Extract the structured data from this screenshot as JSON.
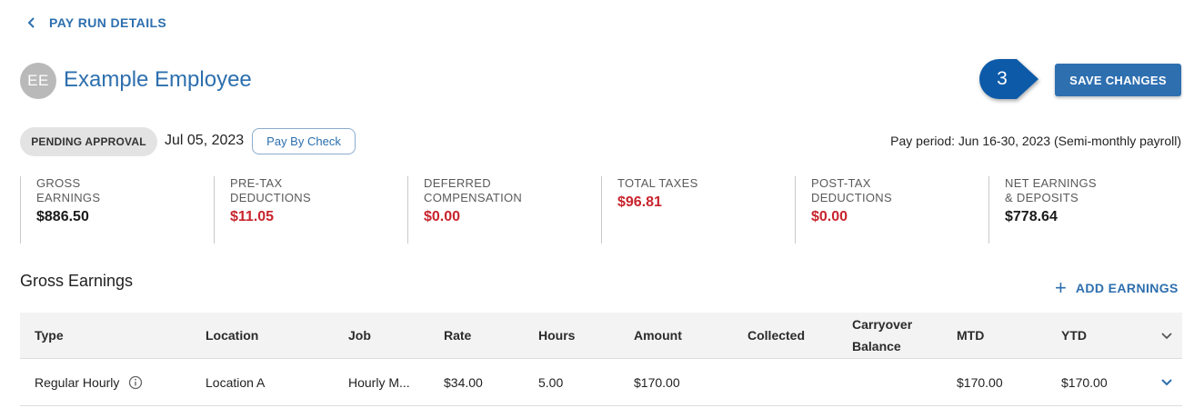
{
  "nav": {
    "back_label": "PAY RUN DETAILS"
  },
  "employee": {
    "initials": "EE",
    "name": "Example Employee"
  },
  "step_badge": {
    "number": "3",
    "color": "#0f5aa8"
  },
  "actions": {
    "save_label": "SAVE CHANGES"
  },
  "status": {
    "badge": "PENDING APPROVAL",
    "pay_date": "Jul 05, 2023",
    "payment_method": "Pay By Check",
    "pay_period": "Pay period: Jun 16-30, 2023 (Semi-monthly payroll)"
  },
  "summary": [
    {
      "label": "GROSS EARNINGS",
      "value": "$886.50"
    },
    {
      "label": "PRE-TAX DEDUCTIONS",
      "value": "$11.05"
    },
    {
      "label": "DEFERRED COMPENSATION",
      "value": "$0.00"
    },
    {
      "label": "TOTAL TAXES",
      "value": "$96.81"
    },
    {
      "label": "POST-TAX DEDUCTIONS",
      "value": "$0.00"
    },
    {
      "label": "NET EARNINGS & DEPOSITS",
      "value": "$778.64"
    }
  ],
  "earnings": {
    "title": "Gross Earnings",
    "add_label": "ADD EARNINGS",
    "columns": {
      "type": "Type",
      "location": "Location",
      "job": "Job",
      "rate": "Rate",
      "hours": "Hours",
      "amount": "Amount",
      "collected": "Collected",
      "carryover_1": "Carryover",
      "carryover_2": "Balance",
      "mtd": "MTD",
      "ytd": "YTD"
    },
    "rows": [
      {
        "type": "Regular Hourly",
        "location": "Location A",
        "job": "Hourly M...",
        "rate": "$34.00",
        "hours": "5.00",
        "amount": "$170.00",
        "collected": "",
        "carryover": "",
        "mtd": "$170.00",
        "ytd": "$170.00"
      }
    ]
  },
  "colors": {
    "accent": "#2d6fae",
    "negative": "#c8242d",
    "button": "#2e6fb0"
  },
  "icons": [
    "chevron-left-icon",
    "info-icon",
    "plus-icon",
    "chevron-down-icon"
  ]
}
